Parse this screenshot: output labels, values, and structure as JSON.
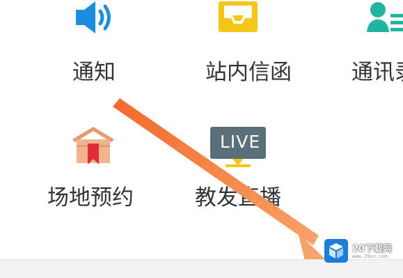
{
  "grid": {
    "items": [
      {
        "label": "通知",
        "icon": "speaker-icon"
      },
      {
        "label": "站内信函",
        "icon": "inbox-tray-icon"
      },
      {
        "label": "通讯录",
        "icon": "contacts-icon"
      },
      {
        "label": "场地预约",
        "icon": "venue-building-icon"
      },
      {
        "label": "教发直播",
        "icon": "live-tv-icon",
        "badge": "LIVE"
      }
    ]
  },
  "colors": {
    "accent_blue": "#1b8ee0",
    "yellow": "#f5c518",
    "teal": "#1fb59e",
    "arrow": "#f47b3b"
  },
  "watermark": {
    "title": "20下载网",
    "sub": "www.20xz.com"
  }
}
